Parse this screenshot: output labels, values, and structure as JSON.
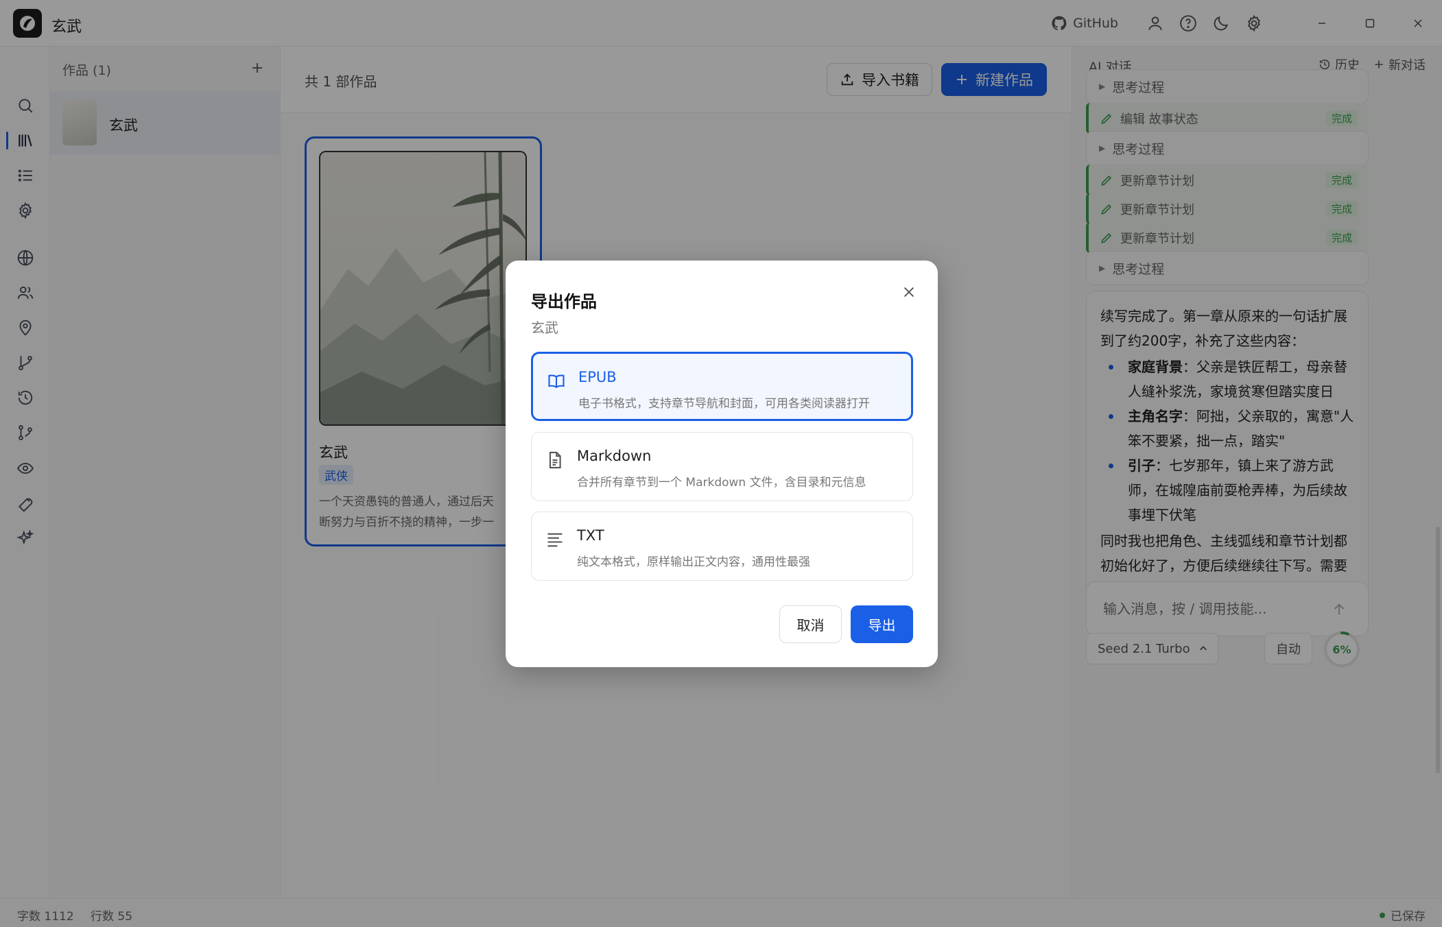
{
  "app": {
    "title": "玄武"
  },
  "titlebar": {
    "github_label": "GitHub",
    "icons": [
      "github-icon",
      "user-icon",
      "help-icon",
      "moon-icon",
      "gear-icon"
    ],
    "window_controls": [
      "minimize-icon",
      "maximize-icon",
      "close-icon"
    ]
  },
  "rail": {
    "items": [
      "search-icon",
      "library-icon",
      "list-icon",
      "gear-icon",
      "globe-icon",
      "users-icon",
      "location-icon",
      "branch-icon",
      "history-icon",
      "flow-icon",
      "eye-icon",
      "wrench-icon",
      "sparkle-icon"
    ],
    "active": "library-icon"
  },
  "works": {
    "header": "作品 (1)",
    "items": [
      {
        "name": "玄武"
      }
    ]
  },
  "main": {
    "count_label": "共 1 部作品",
    "import_label": "导入书籍",
    "new_label": "新建作品",
    "book": {
      "title": "玄武",
      "tag": "武侠",
      "desc_line1": "一个天资愚钝的普通人，通过后天",
      "desc_line2": "断努力与百折不挠的精神，一步一"
    }
  },
  "ai": {
    "title": "AI 对话",
    "history_label": "历史",
    "new_chat_label": "新对话",
    "timeline": [
      {
        "kind": "think",
        "label": "思考过程"
      },
      {
        "kind": "tool",
        "label": "编辑 故事状态",
        "status": "完成"
      },
      {
        "kind": "think",
        "label": "思考过程"
      },
      {
        "kind": "tool",
        "label": "更新章节计划",
        "status": "完成"
      },
      {
        "kind": "tool",
        "label": "更新章节计划",
        "status": "完成"
      },
      {
        "kind": "tool",
        "label": "更新章节计划",
        "status": "完成"
      },
      {
        "kind": "think",
        "label": "思考过程"
      }
    ],
    "message": {
      "intro": "续写完成了。第一章从原来的一句话扩展到了约200字，补充了这些内容：",
      "bullets": [
        {
          "term": "家庭背景",
          "text": "：父亲是铁匠帮工，母亲替人缝补浆洗，家境贫寒但踏实度日"
        },
        {
          "term": "主角名字",
          "text": "：阿拙，父亲取的，寓意\"人笨不要紧，拙一点，踏实\""
        },
        {
          "term": "引子",
          "text": "：七岁那年，镇上来了游方武师，在城隍庙前耍枪弄棒，为后续故事埋下伏笔"
        }
      ],
      "outro": "同时我也把角色、主线弧线和章节计划都初始化好了，方便后续继续往下写。需要接着写吗?"
    },
    "input_placeholder": "输入消息，按 / 调用技能...",
    "model_label": "Seed 2.1 Turbo",
    "auto_label": "自动",
    "usage_percent": 6,
    "usage_label": "6%"
  },
  "status": {
    "words": "字数 1112",
    "lines": "行数 55",
    "saved": "已保存"
  },
  "dialog": {
    "title": "导出作品",
    "subtitle": "玄武",
    "options": [
      {
        "name": "EPUB",
        "desc": "电子书格式，支持章节导航和封面，可用各类阅读器打开",
        "icon": "book-open-icon",
        "selected": true
      },
      {
        "name": "Markdown",
        "desc": "合并所有章节到一个 Markdown 文件，含目录和元信息",
        "icon": "file-text-icon",
        "selected": false
      },
      {
        "name": "TXT",
        "desc": "纯文本格式，原样输出正文内容，通用性最强",
        "icon": "text-lines-icon",
        "selected": false
      }
    ],
    "cancel_label": "取消",
    "export_label": "导出"
  },
  "colors": {
    "accent": "#1a5fe6",
    "success": "#3c9f4f"
  }
}
